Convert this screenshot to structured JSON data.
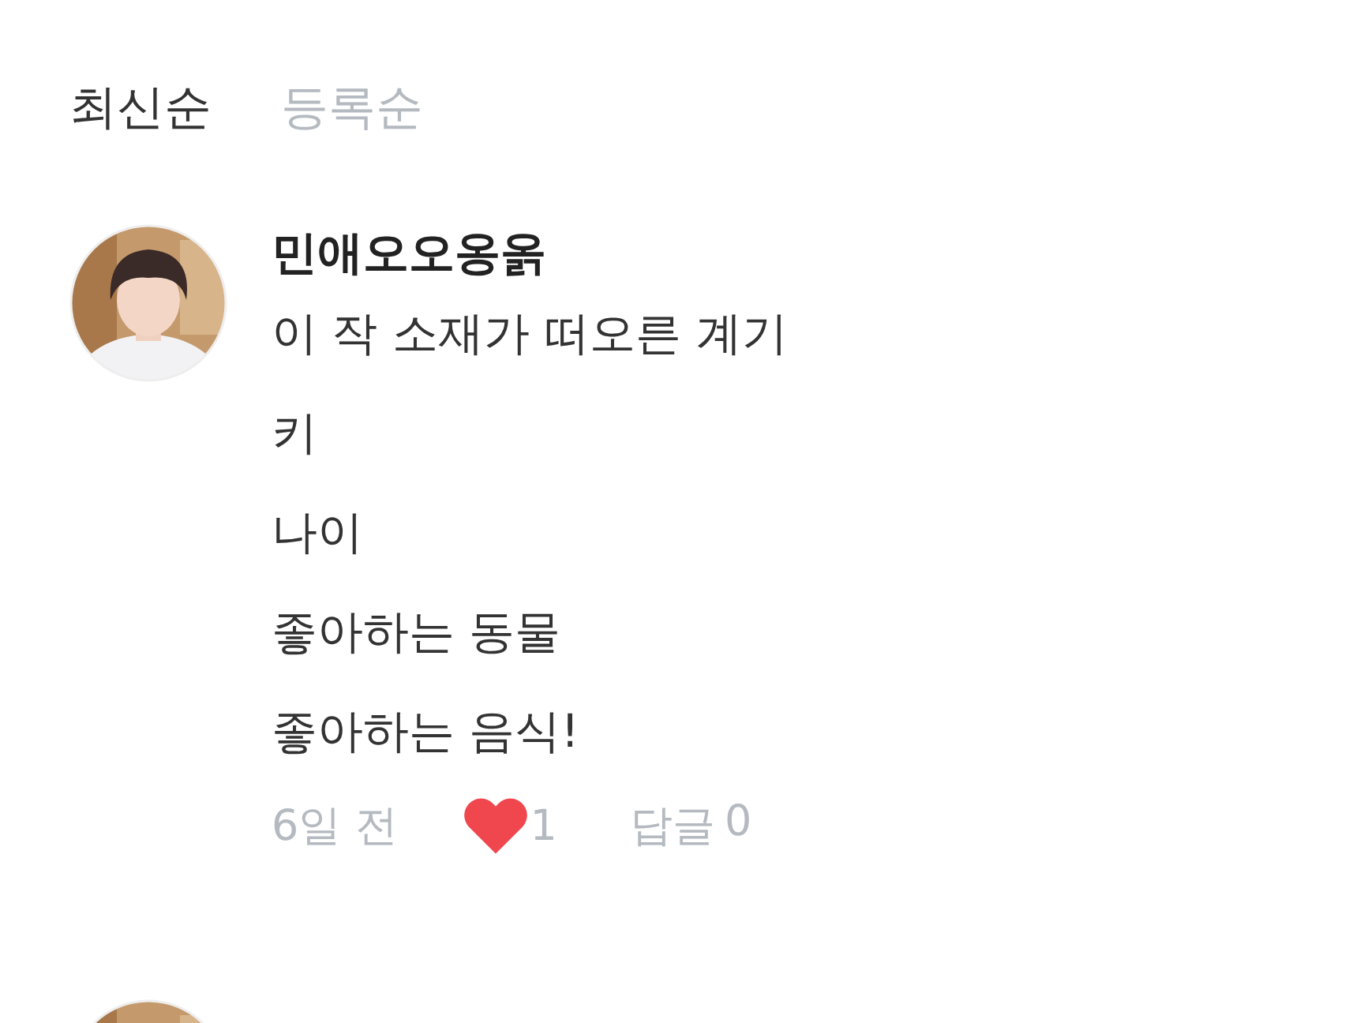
{
  "sort_tabs": [
    {
      "label": "최신순",
      "selected": true
    },
    {
      "label": "등록순",
      "selected": false
    }
  ],
  "comments": [
    {
      "author": "민애오오옹옭",
      "avatar": {
        "kind": "picture"
      },
      "lines": [
        "이 작 소재가 떠오른 계기",
        "키",
        "나이",
        "좋아하는 동물",
        "좋아하는 음식!"
      ],
      "time": "6일 전",
      "likes": "1",
      "liked": true,
      "reply_label": "답글",
      "replies": "0"
    },
    {
      "avatar": {
        "kind": "picture"
      }
    }
  ]
}
